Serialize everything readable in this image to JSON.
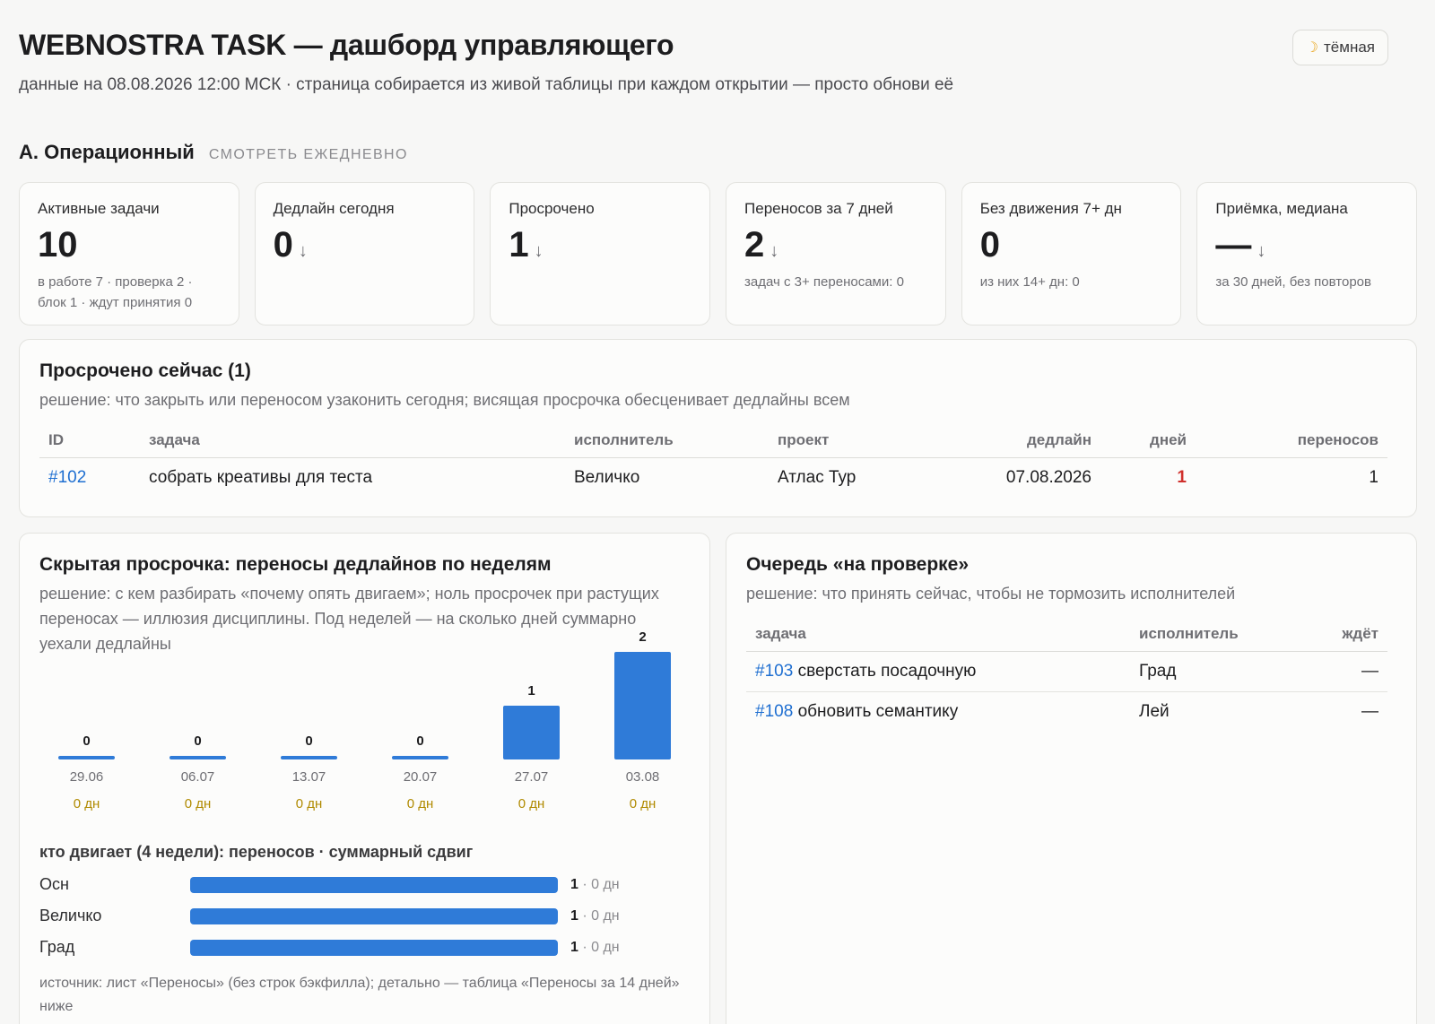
{
  "header": {
    "title": "WEBNOSTRA TASK — дашборд управляющего",
    "subtitle": "данные на 08.08.2026 12:00 МСК · страница собирается из живой таблицы при каждом открытии — просто обнови её",
    "theme_button": "тёмная",
    "theme_icon": "moon-icon"
  },
  "section": {
    "title": "A. Операционный",
    "tag": "СМОТРЕТЬ ЕЖЕДНЕВНО"
  },
  "kpis": [
    {
      "label": "Активные задачи",
      "value": "10",
      "arrow": "",
      "note": "в работе 7 · проверка 2 · блок 1 · ждут принятия 0"
    },
    {
      "label": "Дедлайн сегодня",
      "value": "0",
      "arrow": "↓",
      "note": ""
    },
    {
      "label": "Просрочено",
      "value": "1",
      "arrow": "↓",
      "note": ""
    },
    {
      "label": "Переносов за 7 дней",
      "value": "2",
      "arrow": "↓",
      "note": "задач с 3+ переносами: 0"
    },
    {
      "label": "Без движения 7+ дн",
      "value": "0",
      "arrow": "",
      "note": "из них 14+ дн: 0"
    },
    {
      "label": "Приёмка, медиана",
      "value": "—",
      "arrow": "↓",
      "note": "за 30 дней, без повторов"
    }
  ],
  "overdue": {
    "title": "Просрочено сейчас (1)",
    "desc": "решение: что закрыть или переносом узаконить сегодня; висящая просрочка обесценивает дедлайны всем",
    "columns": {
      "id": "ID",
      "task": "задача",
      "assignee": "исполнитель",
      "project": "проект",
      "deadline": "дедлайн",
      "days": "дней",
      "moves": "переносов"
    },
    "rows": [
      {
        "id": "#102",
        "task": "собрать креативы для теста",
        "assignee": "Величко",
        "project": "Атлас Тур",
        "deadline": "07.08.2026",
        "days": "1",
        "moves": "1"
      }
    ]
  },
  "hidden": {
    "title": "Скрытая просрочка: переносы дедлайнов по неделям",
    "desc": "решение: с кем разбирать «почему опять двигаем»; ноль просрочек при растущих переносах — иллюзия дисциплины. Под неделей — на сколько дней суммарно уехали дедлайны",
    "who_title": "кто двигает (4 недели): переносов · суммарный сдвиг",
    "who": [
      {
        "name": "Осн",
        "count": "1",
        "shift": "0 дн",
        "value": 1
      },
      {
        "name": "Величко",
        "count": "1",
        "shift": "0 дн",
        "value": 1
      },
      {
        "name": "Град",
        "count": "1",
        "shift": "0 дн",
        "value": 1
      }
    ],
    "source": "источник: лист «Переносы» (без строк бэкфилла); детально — таблица «Переносы за 14 дней» ниже"
  },
  "chart_data": {
    "type": "bar",
    "categories": [
      "29.06",
      "06.07",
      "13.07",
      "20.07",
      "27.07",
      "03.08"
    ],
    "values": [
      0,
      0,
      0,
      0,
      1,
      2
    ],
    "sublabels": [
      "0 дн",
      "0 дн",
      "0 дн",
      "0 дн",
      "0 дн",
      "0 дн"
    ],
    "ylim": [
      0,
      2
    ],
    "grid": false,
    "color": "#2f7bd8"
  },
  "review": {
    "title": "Очередь «на проверке»",
    "desc": "решение: что принять сейчас, чтобы не тормозить исполнителей",
    "columns": {
      "task": "задача",
      "assignee": "исполнитель",
      "waits": "ждёт"
    },
    "rows": [
      {
        "id": "#103",
        "task": "сверстать посадочную",
        "assignee": "Град",
        "waits": "—"
      },
      {
        "id": "#108",
        "task": "обновить семантику",
        "assignee": "Лей",
        "waits": "—"
      }
    ]
  }
}
